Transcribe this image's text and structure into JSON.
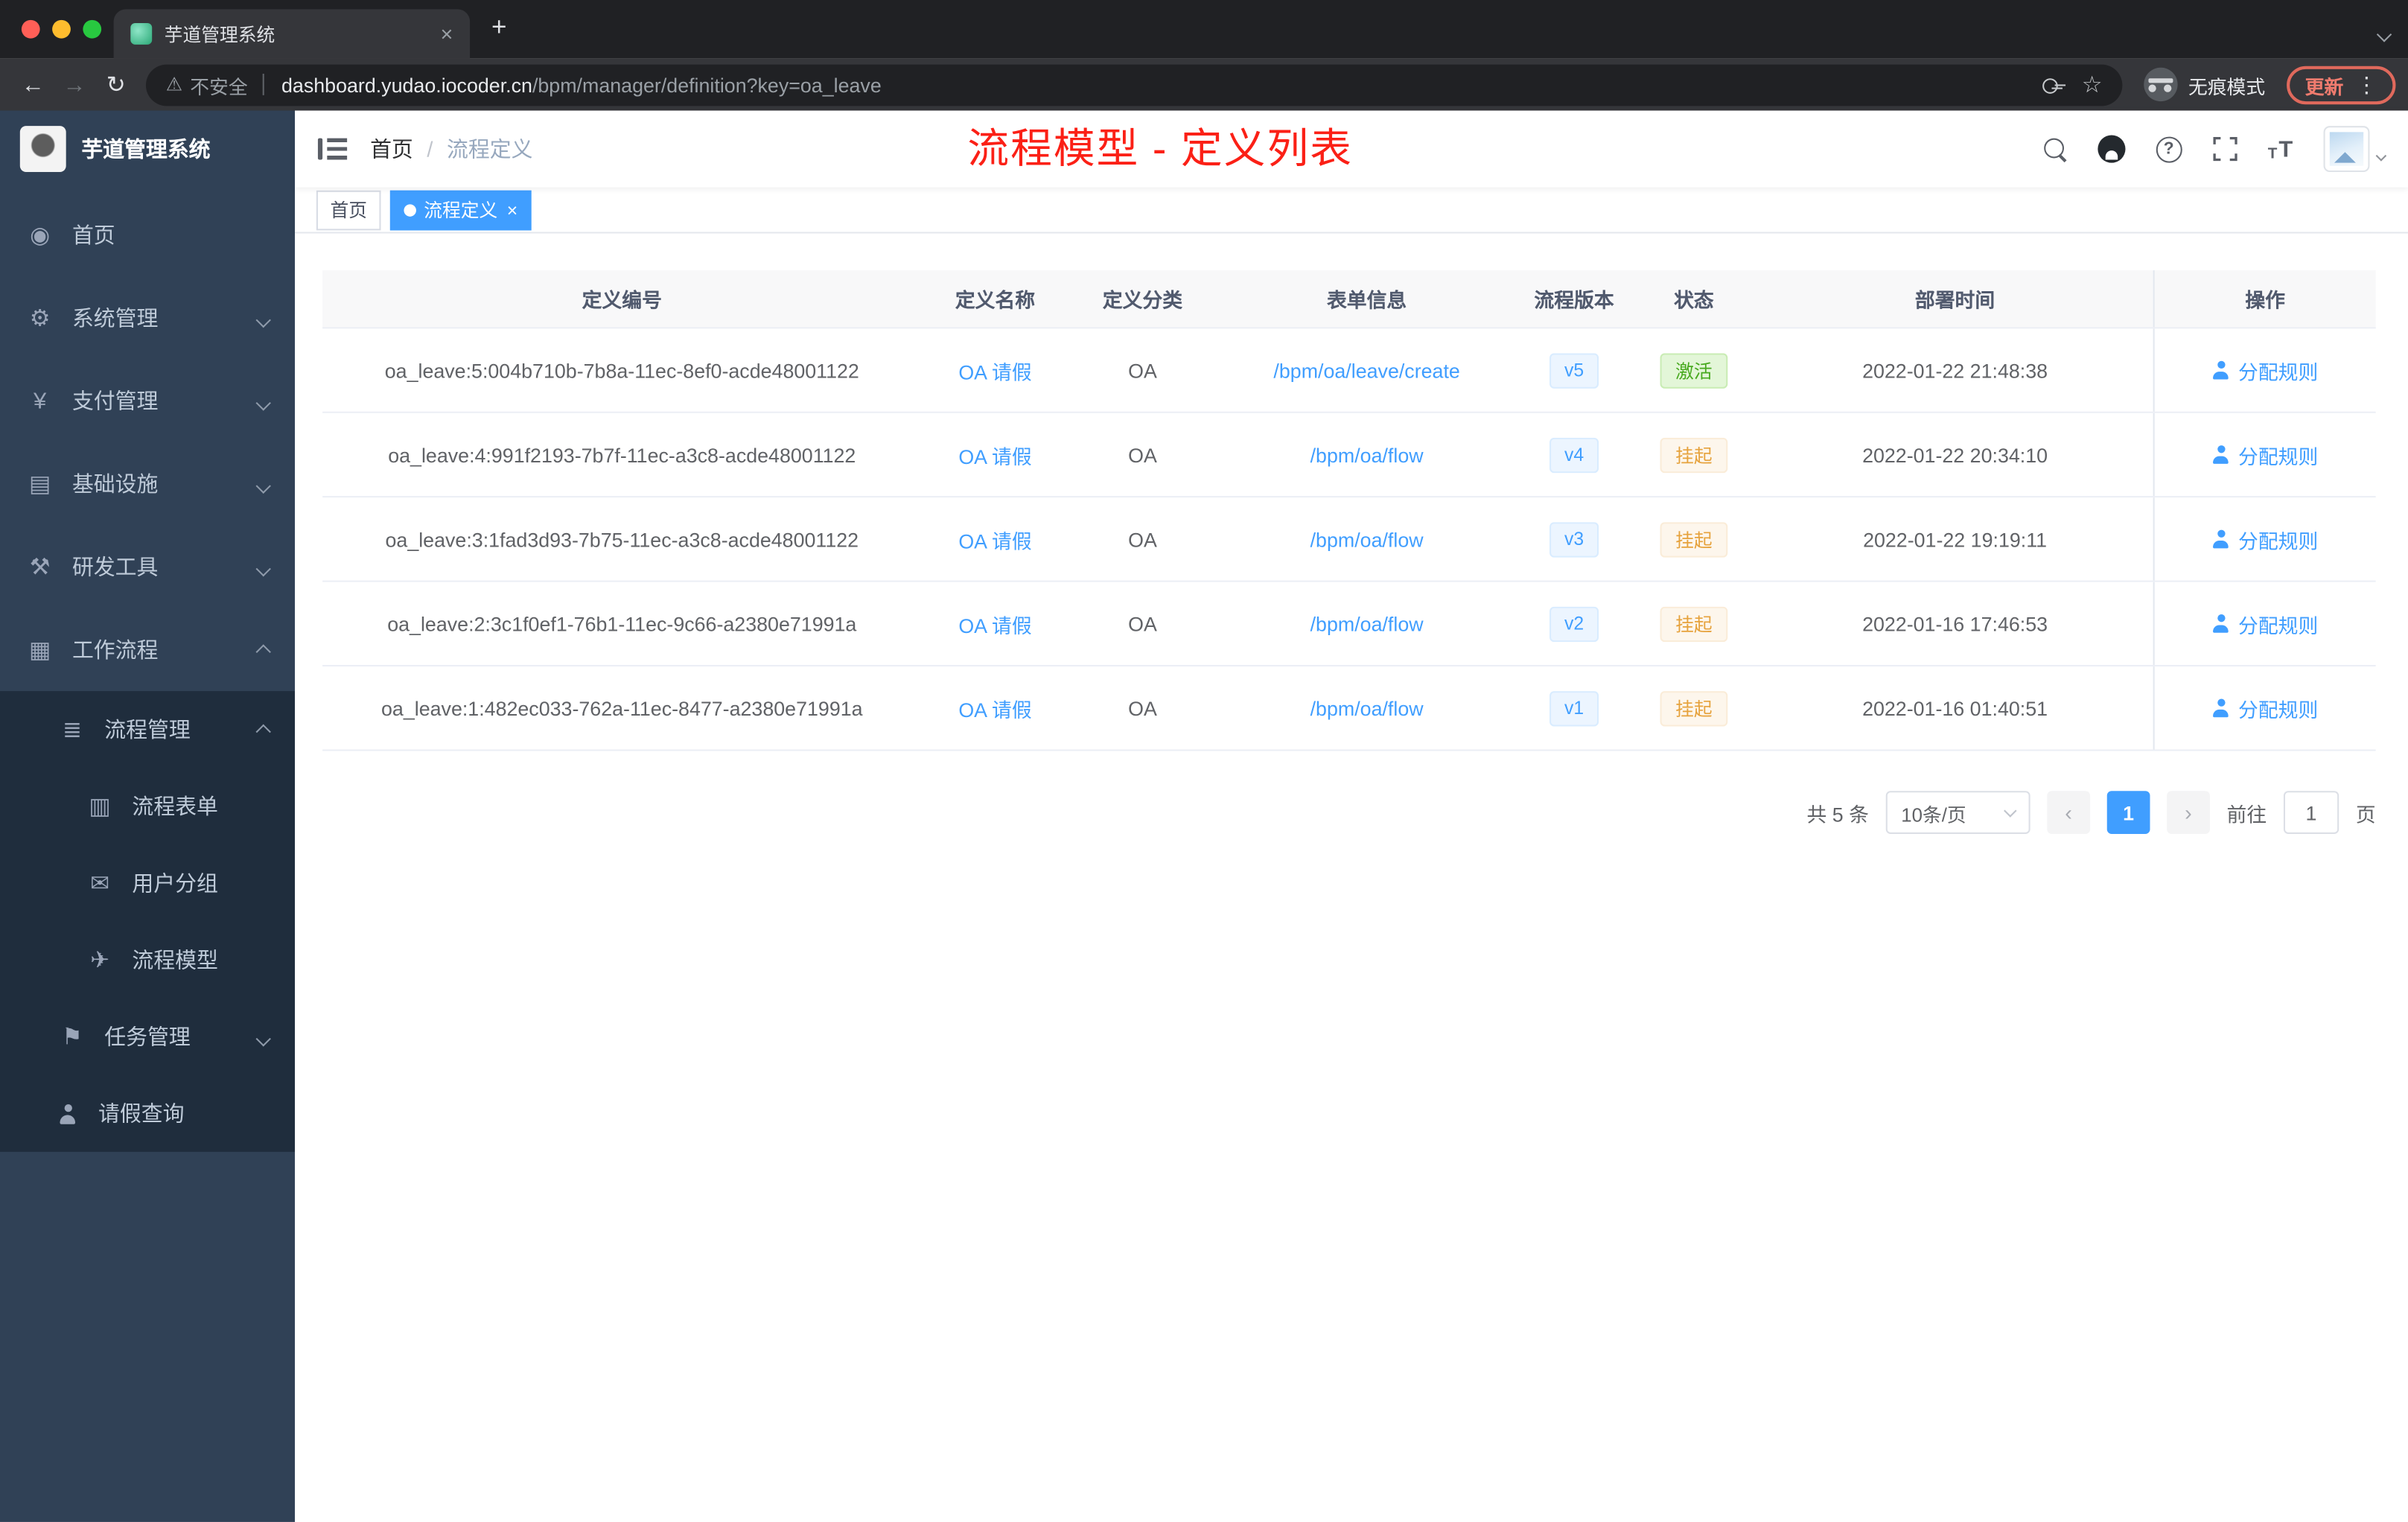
{
  "browser": {
    "tab_title": "芋道管理系统",
    "security_label": "不安全",
    "url_host": "dashboard.yudao.iocoder.cn",
    "url_path": "/bpm/manager/definition?key=oa_leave",
    "incognito_label": "无痕模式",
    "update_label": "更新"
  },
  "icons": {
    "back": "←",
    "forward": "→",
    "reload": "↻",
    "warning": "⚠",
    "star": "☆",
    "dots": "⋮",
    "plus": "+",
    "close": "×",
    "prev": "‹",
    "next": "›"
  },
  "sidebar": {
    "logo_title": "芋道管理系统",
    "items": [
      {
        "key": "home",
        "label": "首页",
        "icon": "◉",
        "level": 1
      },
      {
        "key": "system-mgmt",
        "label": "系统管理",
        "icon": "⚙",
        "level": 1,
        "chevron": "down"
      },
      {
        "key": "payment-mgmt",
        "label": "支付管理",
        "icon": "¥",
        "level": 1,
        "chevron": "down"
      },
      {
        "key": "infrastructure",
        "label": "基础设施",
        "icon": "▤",
        "level": 1,
        "chevron": "down"
      },
      {
        "key": "dev-tools",
        "label": "研发工具",
        "icon": "⚒",
        "level": 1,
        "chevron": "down"
      },
      {
        "key": "workflow",
        "label": "工作流程",
        "icon": "▦",
        "level": 1,
        "chevron": "up"
      },
      {
        "key": "process-mgmt",
        "label": "流程管理",
        "icon": "≣",
        "level": 2,
        "chevron": "up",
        "sub": true
      },
      {
        "key": "process-form",
        "label": "流程表单",
        "icon": "▥",
        "level": 3,
        "sub": true
      },
      {
        "key": "user-group",
        "label": "用户分组",
        "icon": "✉",
        "level": 3,
        "sub": true
      },
      {
        "key": "process-model",
        "label": "流程模型",
        "icon": "✈",
        "level": 3,
        "sub": true
      },
      {
        "key": "task-mgmt",
        "label": "任务管理",
        "icon": "⚑",
        "level": 2,
        "chevron": "down",
        "sub": true
      },
      {
        "key": "leave-query",
        "label": "请假查询",
        "icon": "user",
        "level": 2,
        "sub": true
      }
    ]
  },
  "header": {
    "breadcrumb": [
      "首页",
      "流程定义"
    ],
    "annotation": "流程模型 - 定义列表"
  },
  "tags": [
    {
      "label": "首页",
      "active": false
    },
    {
      "label": "流程定义",
      "active": true
    }
  ],
  "table": {
    "columns": [
      "定义编号",
      "定义名称",
      "定义分类",
      "表单信息",
      "流程版本",
      "状态",
      "部署时间",
      "操作"
    ],
    "action_label": "分配规则",
    "rows": [
      {
        "id": "oa_leave:5:004b710b-7b8a-11ec-8ef0-acde48001122",
        "name": "OA 请假",
        "category": "OA",
        "form": "/bpm/oa/leave/create",
        "version": "v5",
        "status": "激活",
        "status_type": "success",
        "time": "2022-01-22 21:48:38"
      },
      {
        "id": "oa_leave:4:991f2193-7b7f-11ec-a3c8-acde48001122",
        "name": "OA 请假",
        "category": "OA",
        "form": "/bpm/oa/flow",
        "version": "v4",
        "status": "挂起",
        "status_type": "warning",
        "time": "2022-01-22 20:34:10"
      },
      {
        "id": "oa_leave:3:1fad3d93-7b75-11ec-a3c8-acde48001122",
        "name": "OA 请假",
        "category": "OA",
        "form": "/bpm/oa/flow",
        "version": "v3",
        "status": "挂起",
        "status_type": "warning",
        "time": "2022-01-22 19:19:11"
      },
      {
        "id": "oa_leave:2:3c1f0ef1-76b1-11ec-9c66-a2380e71991a",
        "name": "OA 请假",
        "category": "OA",
        "form": "/bpm/oa/flow",
        "version": "v2",
        "status": "挂起",
        "status_type": "warning",
        "time": "2022-01-16 17:46:53"
      },
      {
        "id": "oa_leave:1:482ec033-762a-11ec-8477-a2380e71991a",
        "name": "OA 请假",
        "category": "OA",
        "form": "/bpm/oa/flow",
        "version": "v1",
        "status": "挂起",
        "status_type": "warning",
        "time": "2022-01-16 01:40:51"
      }
    ]
  },
  "pagination": {
    "total": "共 5 条",
    "page_size": "10条/页",
    "current_page": "1",
    "goto_label": "前往",
    "goto_value": "1",
    "page_unit": "页"
  },
  "colors": {
    "accent": "#409eff",
    "success": "#67c23a",
    "warning": "#e6a23c",
    "annotation": "#fb2016",
    "sidebar_bg": "#304156",
    "submenu_bg": "#1f2d3d"
  }
}
